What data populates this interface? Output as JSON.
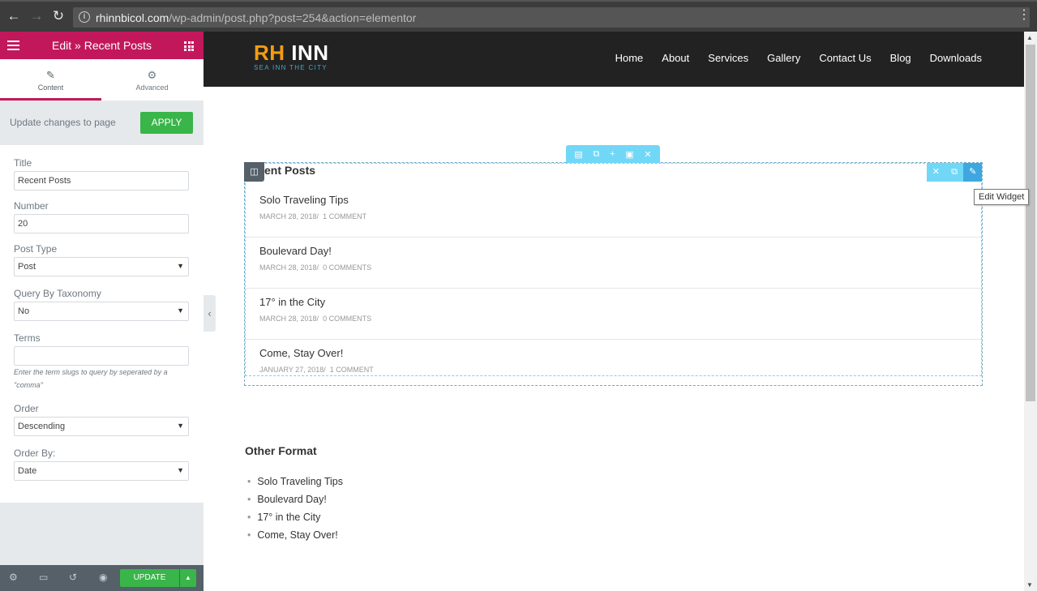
{
  "browser": {
    "back_icon": "arrow-left-icon",
    "forward_icon": "arrow-right-icon",
    "reload_icon": "reload-icon",
    "url_host": "rhinnbicol.com",
    "url_path": "/wp-admin/post.php?post=254&action=elementor"
  },
  "panel": {
    "title": "Edit » Recent Posts",
    "tabs": [
      {
        "label": "Content",
        "icon": "pencil-icon"
      },
      {
        "label": "Advanced",
        "icon": "gear-icon"
      }
    ],
    "apply_text": "Update changes to page",
    "apply_button": "APPLY",
    "controls": {
      "title_label": "Title",
      "title_value": "Recent Posts",
      "number_label": "Number",
      "number_value": "20",
      "post_type_label": "Post Type",
      "post_type_value": "Post",
      "taxonomy_label": "Query By Taxonomy",
      "taxonomy_value": "No",
      "terms_label": "Terms",
      "terms_value": "",
      "terms_help": "Enter the term slugs to query by seperated by a \"comma\"",
      "order_label": "Order",
      "order_value": "Descending",
      "order_by_label": "Order By:",
      "order_by_value": "Date"
    },
    "footer": {
      "update_button": "UPDATE"
    }
  },
  "site": {
    "logo_rh": "RH",
    "logo_inn": "INN",
    "tagline": "SEA INN THE CITY",
    "nav": [
      "Home",
      "About",
      "Services",
      "Gallery",
      "Contact Us",
      "Blog",
      "Downloads"
    ]
  },
  "widget": {
    "heading": "ent Posts",
    "tooltip": "Edit Widget",
    "posts": [
      {
        "title": "Solo Traveling Tips",
        "date": "March 28, 2018",
        "comments": "1 Comment"
      },
      {
        "title": "Boulevard Day!",
        "date": "March 28, 2018",
        "comments": "0 Comments"
      },
      {
        "title": "17° in the City",
        "date": "March 28, 2018",
        "comments": "0 Comments"
      },
      {
        "title": "Come, Stay Over!",
        "date": "January 27, 2018",
        "comments": "1 Comment"
      }
    ]
  },
  "other_format": {
    "heading": "Other Format",
    "items": [
      "Solo Traveling Tips",
      "Boulevard Day!",
      "17° in the City",
      "Come, Stay Over!"
    ]
  }
}
